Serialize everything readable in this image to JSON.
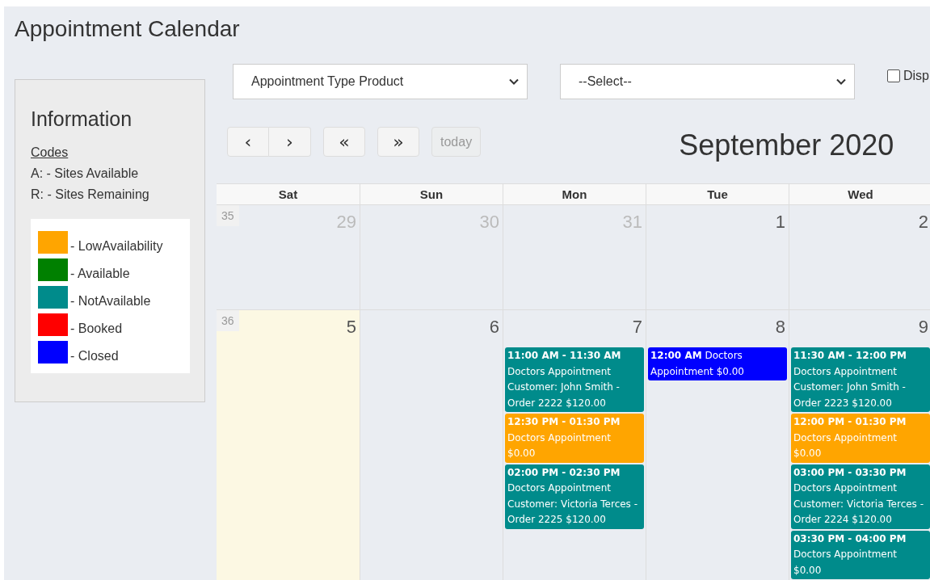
{
  "page": {
    "title": "Appointment Calendar"
  },
  "info": {
    "title": "Information",
    "codes_heading": "Codes",
    "codes": [
      "A: - Sites Available",
      "R: - Sites Remaining"
    ],
    "legend": [
      {
        "color": "#ffa500",
        "label": "- LowAvailability"
      },
      {
        "color": "#008000",
        "label": "- Available"
      },
      {
        "color": "#008b8b",
        "label": "- NotAvailable"
      },
      {
        "color": "#ff0000",
        "label": "- Booked"
      },
      {
        "color": "#0000ff",
        "label": "- Closed"
      }
    ]
  },
  "filters": {
    "selects": [
      {
        "value": "Appointment Type Product"
      },
      {
        "value": "--Select--"
      }
    ],
    "checkbox": {
      "label": "Disp",
      "checked": false
    }
  },
  "toolbar": {
    "button_groups": [
      [
        {
          "label": "‹",
          "disabled": false
        },
        {
          "label": "›",
          "disabled": false
        }
      ],
      [
        {
          "label": "«",
          "disabled": false
        }
      ],
      [
        {
          "label": "»",
          "disabled": false
        }
      ],
      [
        {
          "label": "today",
          "disabled": true
        }
      ]
    ],
    "month": "September 2020"
  },
  "calendar": {
    "columns": [
      "Sat",
      "Sun",
      "Mon",
      "Tue",
      "Wed"
    ],
    "weeks": [
      {
        "number": "35",
        "days": [
          {
            "date": "29",
            "other_month": true,
            "today": false
          },
          {
            "date": "30",
            "other_month": true,
            "today": false
          },
          {
            "date": "31",
            "other_month": true,
            "today": false
          },
          {
            "date": "1",
            "other_month": false,
            "today": false
          },
          {
            "date": "2",
            "other_month": false,
            "today": false
          }
        ]
      },
      {
        "number": "36",
        "days": [
          {
            "date": "5",
            "other_month": false,
            "today": true
          },
          {
            "date": "6",
            "other_month": false,
            "today": false
          },
          {
            "date": "7",
            "other_month": false,
            "today": false,
            "events": [
              {
                "kind": "block",
                "color": "#008b8b",
                "time": "11:00 AM - 11:30 AM",
                "text": "Doctors Appointment Customer: John Smith - Order 2222 $120.00"
              },
              {
                "kind": "block",
                "color": "#ffa500",
                "time": "12:30 PM - 01:30 PM",
                "text": "Doctors Appointment $0.00"
              },
              {
                "kind": "block",
                "color": "#008b8b",
                "time": "02:00 PM - 02:30 PM",
                "text": "Doctors Appointment Customer: Victoria Terces - Order 2225 $120.00"
              }
            ]
          },
          {
            "date": "8",
            "other_month": false,
            "today": false,
            "events": [
              {
                "kind": "inline",
                "color": "#0000ff",
                "time": "12:00 AM",
                "text": "Doctors Appointment $0.00"
              }
            ]
          },
          {
            "date": "9",
            "other_month": false,
            "today": false,
            "events": [
              {
                "kind": "block",
                "color": "#008b8b",
                "time": "11:30 AM - 12:00 PM",
                "text": "Doctors Appointment Customer: John Smith - Order 2223 $120.00"
              },
              {
                "kind": "block",
                "color": "#ffa500",
                "time": "12:00 PM - 01:30 PM",
                "text": "Doctors Appointment $0.00"
              },
              {
                "kind": "block",
                "color": "#008b8b",
                "time": "03:00 PM - 03:30 PM",
                "text": "Doctors Appointment Customer: Victoria Terces - Order 2224 $120.00"
              },
              {
                "kind": "block",
                "color": "#008b8b",
                "time": "03:30 PM - 04:00 PM",
                "text": "Doctors Appointment $0.00"
              }
            ]
          }
        ]
      }
    ]
  }
}
